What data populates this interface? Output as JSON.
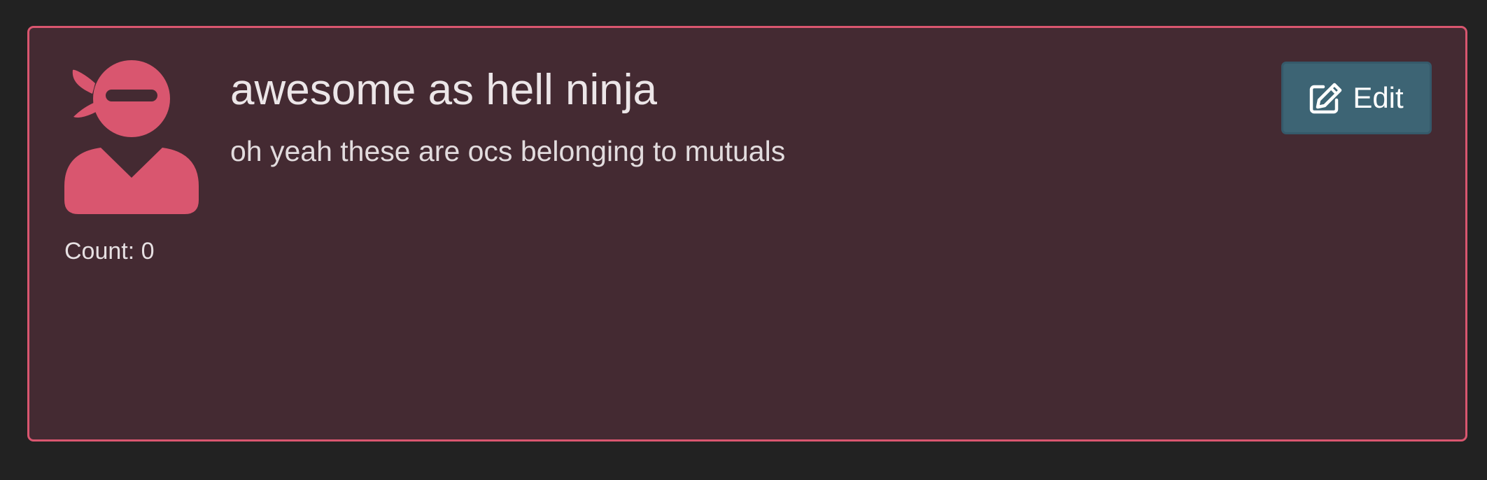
{
  "card": {
    "title": "awesome as hell ninja",
    "description": "oh yeah these are ocs belonging to mutuals",
    "count_text": "Count: 0",
    "avatar_icon": "ninja-user-icon",
    "edit_icon": "edit-icon",
    "edit_label": "Edit"
  },
  "colors": {
    "page_background": "#222222",
    "card_background": "#442a32",
    "card_border": "#d9566f",
    "avatar": "#d9566f",
    "edit_button": "#3d6474",
    "text": "#ece6e8"
  }
}
